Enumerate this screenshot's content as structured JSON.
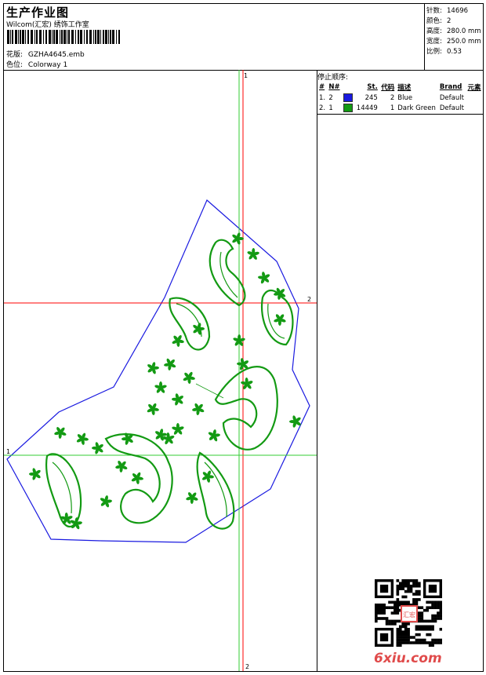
{
  "header": {
    "title": "生产作业图",
    "subtitle": "Wilcom(汇宏) 绣饰工作室",
    "design_file_label": "花版:",
    "design_file": "GZHA4645.emb",
    "colorway_label": "色位:",
    "colorway": "Colorway 1"
  },
  "specs": [
    {
      "label": "针数:",
      "value": "14696"
    },
    {
      "label": "颜色:",
      "value": "2"
    },
    {
      "label": "高度:",
      "value": "280.0 mm"
    },
    {
      "label": "宽度:",
      "value": "250.0 mm"
    },
    {
      "label": "比例:",
      "value": "0.53"
    }
  ],
  "stop_sequence": {
    "title": "停止顺序:",
    "columns": {
      "num": "#",
      "needle": "N#",
      "stitches": "St.",
      "code": "代码",
      "description": "描述",
      "brand": "Brand",
      "element": "元素"
    },
    "rows": [
      {
        "num": "1.",
        "needle": "2",
        "color": "#1a1ae0",
        "stitches": "245",
        "code": "2",
        "description": "Blue",
        "brand": "Default"
      },
      {
        "num": "2.",
        "needle": "1",
        "color": "#139a13",
        "stitches": "14449",
        "code": "1",
        "description": "Dark Green",
        "brand": "Default"
      }
    ]
  },
  "guides": {
    "top": "1",
    "right": "2",
    "left": "1",
    "bottom": "2"
  },
  "colors": {
    "outline": "#1a1ae0",
    "embroidery": "#139a13",
    "guide_red": "#ff0000",
    "guide_green": "#33cc33",
    "watermark": "#e04b4b"
  },
  "watermark": {
    "text": "6xiu.com",
    "seal": "汇宏"
  }
}
